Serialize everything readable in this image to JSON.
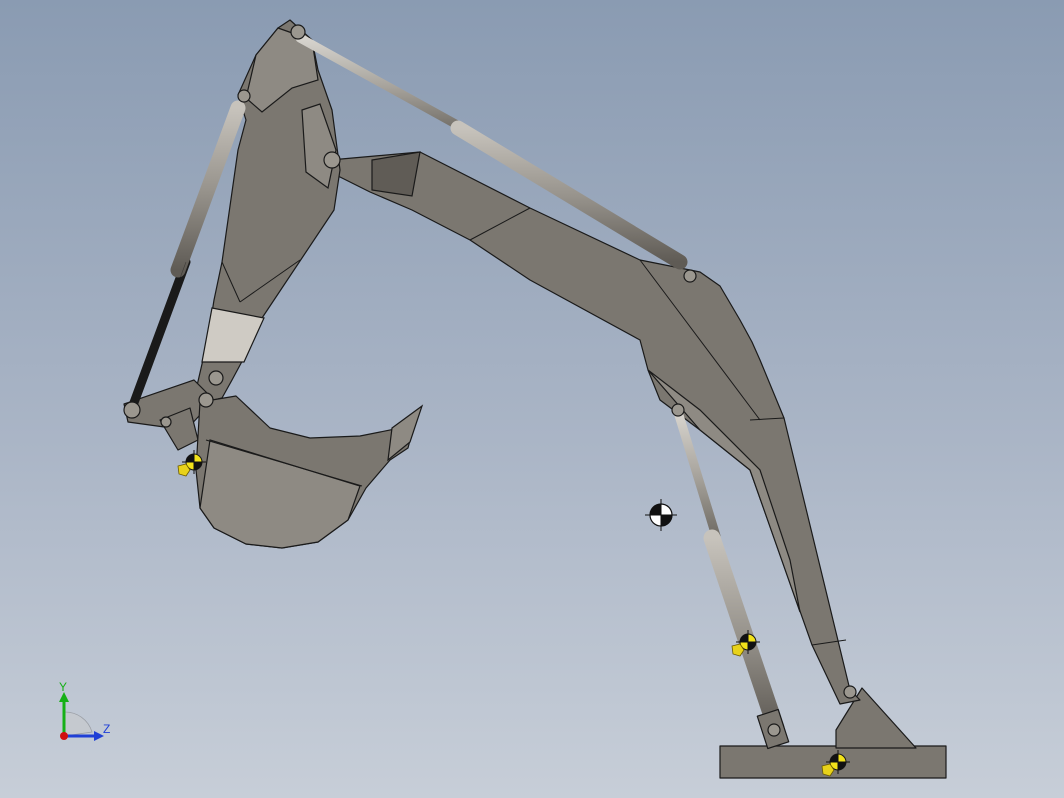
{
  "view": {
    "background_top": "#8a9bb2",
    "background_bottom": "#c7ced8",
    "part_color": "#7b7770"
  },
  "triad": {
    "y_label": "Y",
    "z_label": "Z",
    "y_color": "#16b016",
    "z_color": "#1f3fd6",
    "x_color": "#d01010"
  },
  "markers": {
    "center_of_mass": "center-of-mass-symbol",
    "mass_point": "mass-point-symbol"
  }
}
